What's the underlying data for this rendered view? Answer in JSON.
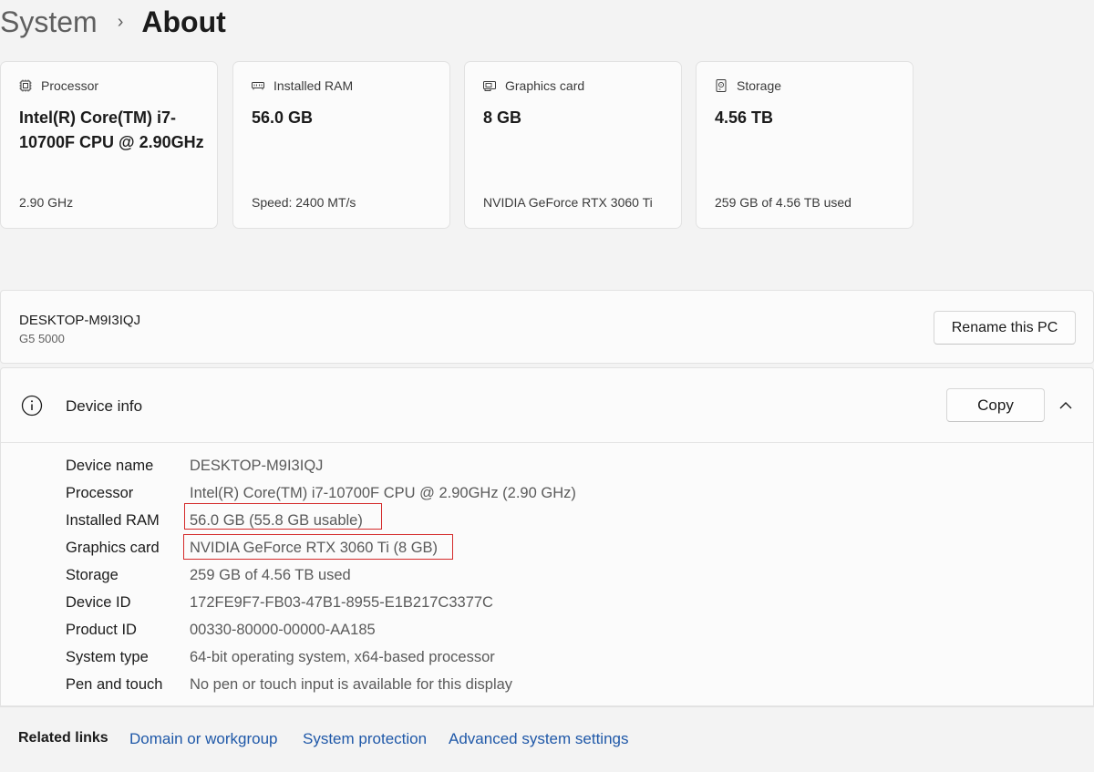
{
  "breadcrumb": {
    "parent": "System",
    "separator": "›",
    "current": "About"
  },
  "cards": [
    {
      "icon": "processor-icon",
      "label": "Processor",
      "value": "Intel(R) Core(TM) i7-10700F CPU @ 2.90GHz",
      "sub": "2.90 GHz"
    },
    {
      "icon": "ram-icon",
      "label": "Installed RAM",
      "value": "56.0 GB",
      "sub": "Speed: 2400 MT/s"
    },
    {
      "icon": "graphics-card-icon",
      "label": "Graphics card",
      "value": "8 GB",
      "sub": "NVIDIA GeForce RTX 3060 Ti"
    },
    {
      "icon": "storage-icon",
      "label": "Storage",
      "value": "4.56 TB",
      "sub": "259 GB of 4.56 TB used"
    }
  ],
  "pc": {
    "name": "DESKTOP-M9I3IQJ",
    "model": "G5 5000",
    "rename_label": "Rename this PC"
  },
  "device_info": {
    "title": "Device info",
    "copy_label": "Copy",
    "icon": "info-icon",
    "specs": [
      {
        "label": "Device name",
        "value": "DESKTOP-M9I3IQJ"
      },
      {
        "label": "Processor",
        "value": "Intel(R) Core(TM) i7-10700F CPU @ 2.90GHz (2.90 GHz)"
      },
      {
        "label": "Installed RAM",
        "value": "56.0 GB (55.8 GB usable)"
      },
      {
        "label": "Graphics card",
        "value": "NVIDIA GeForce RTX 3060 Ti (8 GB)"
      },
      {
        "label": "Storage",
        "value": "259 GB of 4.56 TB used"
      },
      {
        "label": "Device ID",
        "value": "172FE9F7-FB03-47B1-8955-E1B217C3377C"
      },
      {
        "label": "Product ID",
        "value": "00330-80000-00000-AA185"
      },
      {
        "label": "System type",
        "value": "64-bit operating system, x64-based processor"
      },
      {
        "label": "Pen and touch",
        "value": "No pen or touch input is available for this display"
      }
    ]
  },
  "related": {
    "label": "Related links",
    "links": [
      "Domain or workgroup",
      "System protection",
      "Advanced system settings"
    ]
  },
  "colors": {
    "highlight": "#d42a2a",
    "link": "#1f58a8",
    "background": "#f3f3f3",
    "card": "#fbfbfb"
  }
}
